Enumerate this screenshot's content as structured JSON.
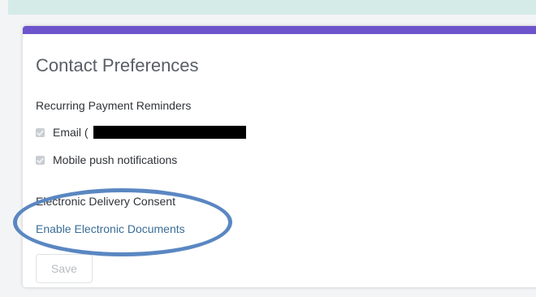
{
  "contact_preferences": {
    "title": "Contact Preferences",
    "recurring_payment_reminders": {
      "heading": "Recurring Payment Reminders",
      "options": [
        {
          "label": "Email (",
          "checked": true,
          "redacted": true
        },
        {
          "label": "Mobile push notifications",
          "checked": true
        }
      ]
    },
    "electronic_delivery_consent": {
      "heading": "Electronic Delivery Consent",
      "link_label": "Enable Electronic Documents"
    },
    "save_label": "Save"
  },
  "colors": {
    "accent_bar": "#6e54cc",
    "link": "#3a6d98",
    "highlight_ellipse": "#5a87c2",
    "top_strip": "#d5ebe8"
  }
}
